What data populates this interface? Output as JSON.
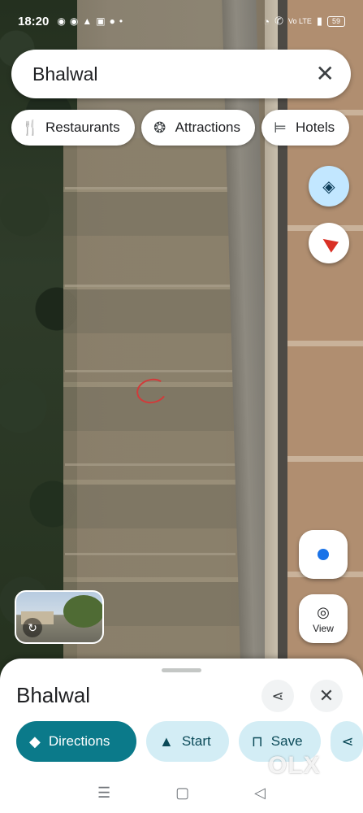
{
  "status_bar": {
    "time": "18:20",
    "network": "Vo LTE",
    "battery": "59"
  },
  "search": {
    "query": "Bhalwal"
  },
  "chips": [
    {
      "label": "Restaurants",
      "icon": "fork-knife-icon"
    },
    {
      "label": "Attractions",
      "icon": "ferris-wheel-icon"
    },
    {
      "label": "Hotels",
      "icon": "bed-icon"
    }
  ],
  "map_controls": {
    "view_label": "View"
  },
  "sheet": {
    "place_name": "Bhalwal",
    "actions": [
      {
        "label": "Directions",
        "icon": "directions-icon"
      },
      {
        "label": "Start",
        "icon": "navigation-arrow-icon"
      },
      {
        "label": "Save",
        "icon": "bookmark-icon"
      }
    ]
  },
  "watermark": "OLX",
  "colors": {
    "accent": "#0b7a8a",
    "chip_bg": "#d3edf5",
    "location_dot": "#1a73e8",
    "compass_red": "#d93025"
  }
}
